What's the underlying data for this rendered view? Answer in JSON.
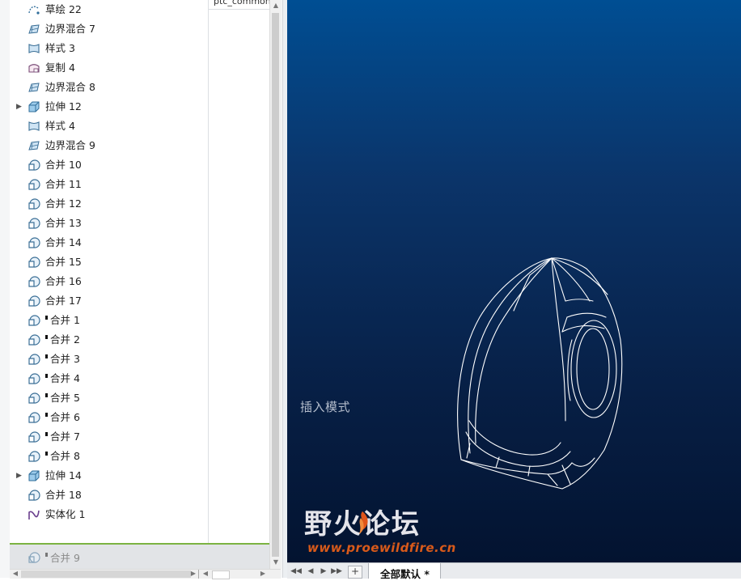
{
  "model_tree": {
    "column_header": "ptc_common_na",
    "items": [
      {
        "label": "草绘 22",
        "icon": "sketch-icon",
        "expandable": false,
        "marker": false
      },
      {
        "label": "边界混合 7",
        "icon": "boundary-blend-icon",
        "expandable": false,
        "marker": false
      },
      {
        "label": "样式 3",
        "icon": "style-icon",
        "expandable": false,
        "marker": false
      },
      {
        "label": "复制 4",
        "icon": "copy-surface-icon",
        "expandable": false,
        "marker": false
      },
      {
        "label": "边界混合 8",
        "icon": "boundary-blend-icon",
        "expandable": false,
        "marker": false
      },
      {
        "label": "拉伸 12",
        "icon": "extrude-icon",
        "expandable": true,
        "marker": false
      },
      {
        "label": "样式 4",
        "icon": "style-icon",
        "expandable": false,
        "marker": false
      },
      {
        "label": "边界混合 9",
        "icon": "boundary-blend-icon",
        "expandable": false,
        "marker": false
      },
      {
        "label": "合并 10",
        "icon": "merge-icon",
        "expandable": false,
        "marker": false
      },
      {
        "label": "合并 11",
        "icon": "merge-icon",
        "expandable": false,
        "marker": false
      },
      {
        "label": "合并 12",
        "icon": "merge-icon",
        "expandable": false,
        "marker": false
      },
      {
        "label": "合并 13",
        "icon": "merge-icon",
        "expandable": false,
        "marker": false
      },
      {
        "label": "合并 14",
        "icon": "merge-icon",
        "expandable": false,
        "marker": false
      },
      {
        "label": "合并 15",
        "icon": "merge-icon",
        "expandable": false,
        "marker": false
      },
      {
        "label": "合并 16",
        "icon": "merge-icon",
        "expandable": false,
        "marker": false
      },
      {
        "label": "合并 17",
        "icon": "merge-icon",
        "expandable": false,
        "marker": false
      },
      {
        "label": "合并 1",
        "icon": "merge-icon",
        "expandable": false,
        "marker": true
      },
      {
        "label": "合并 2",
        "icon": "merge-icon",
        "expandable": false,
        "marker": true
      },
      {
        "label": "合并 3",
        "icon": "merge-icon",
        "expandable": false,
        "marker": true
      },
      {
        "label": "合并 4",
        "icon": "merge-icon",
        "expandable": false,
        "marker": true
      },
      {
        "label": "合并 5",
        "icon": "merge-icon",
        "expandable": false,
        "marker": true
      },
      {
        "label": "合并 6",
        "icon": "merge-icon",
        "expandable": false,
        "marker": true
      },
      {
        "label": "合并 7",
        "icon": "merge-icon",
        "expandable": false,
        "marker": true
      },
      {
        "label": "合并 8",
        "icon": "merge-icon",
        "expandable": false,
        "marker": true
      },
      {
        "label": "拉伸 14",
        "icon": "extrude-icon",
        "expandable": true,
        "marker": false
      },
      {
        "label": "合并 18",
        "icon": "merge-icon",
        "expandable": false,
        "marker": false
      },
      {
        "label": "实体化 1",
        "icon": "solidify-icon",
        "expandable": false,
        "marker": false
      }
    ],
    "suppressed_item": {
      "label": "合并 9",
      "icon": "merge-icon",
      "marker": true
    }
  },
  "viewport": {
    "mode_text": "插入模式"
  },
  "watermark": {
    "title": "野火论坛",
    "url": "www.proewildfire.cn"
  },
  "sheet_bar": {
    "tab_label": "全部默认 *",
    "add_label": "+"
  },
  "colors": {
    "insert_line": "#7cb342",
    "viewport_top": "#004e93",
    "viewport_bottom": "#031330",
    "wireframe": "#ffffff"
  }
}
